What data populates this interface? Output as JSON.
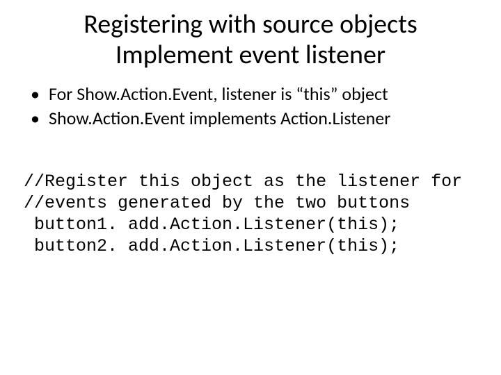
{
  "title_line1": "Registering with source objects",
  "title_line2": "Implement event listener",
  "bullets": [
    " For Show.Action.Event, listener is “this” object",
    "Show.Action.Event implements Action.Listener"
  ],
  "code_lines": [
    "//Register this object as the listener for",
    "//events generated by the two buttons",
    " button1. add.Action.Listener(this);",
    " button2. add.Action.Listener(this);"
  ]
}
